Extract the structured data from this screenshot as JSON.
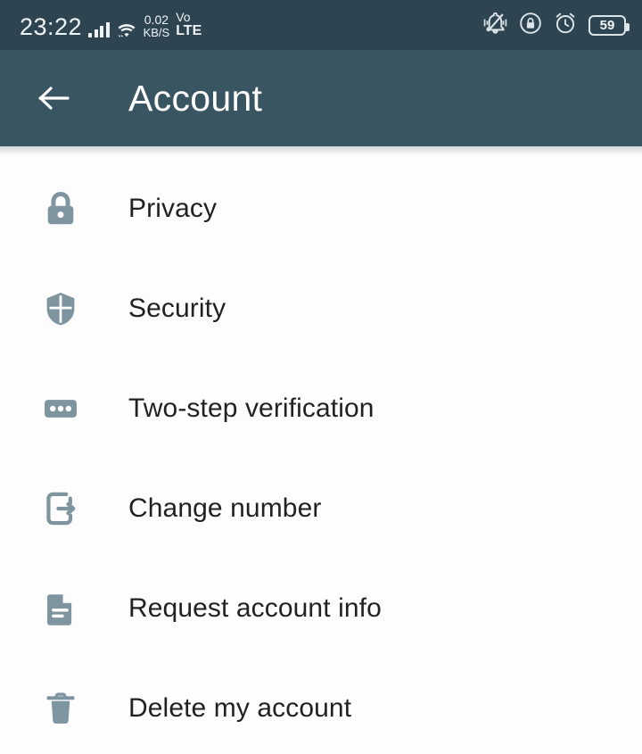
{
  "status_bar": {
    "time": "23:22",
    "network_speed_value": "0.02",
    "network_speed_unit": "KB/S",
    "volte_top": "Vo",
    "volte_bottom": "LTE",
    "battery_percent": "59",
    "icons": [
      "signal-bars-icon",
      "wifi-icon",
      "silent-bell-icon",
      "screen-lock-icon",
      "alarm-clock-icon",
      "battery-icon"
    ],
    "background_color": "#2e4450",
    "foreground_color": "#eef3f5"
  },
  "app_bar": {
    "title": "Account",
    "back_icon": "back-arrow-icon",
    "background_color": "#3a5562",
    "title_color": "#ffffff"
  },
  "settings_list": {
    "icon_color": "#7e95a0",
    "label_color": "#1f2123",
    "items": [
      {
        "label": "Privacy",
        "icon": "lock-icon"
      },
      {
        "label": "Security",
        "icon": "shield-icon"
      },
      {
        "label": "Two-step verification",
        "icon": "pin-dots-icon"
      },
      {
        "label": "Change number",
        "icon": "phone-exit-arrow-icon"
      },
      {
        "label": "Request account info",
        "icon": "document-icon"
      },
      {
        "label": "Delete my account",
        "icon": "trash-icon"
      }
    ]
  }
}
